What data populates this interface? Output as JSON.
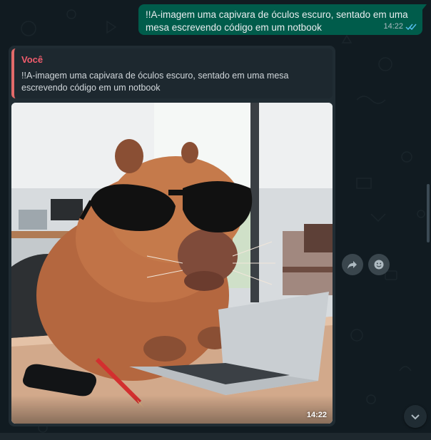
{
  "outgoing_message": {
    "text": "!!A-imagem uma capivara de óculos escuro, sentado em uma mesa escrevendo código em um notbook",
    "time": "14:22",
    "status_icon": "double-check-icon",
    "status_color": "#53bdeb"
  },
  "incoming_message": {
    "quote_author": "Você",
    "quote_text": "!!A-imagem uma capivara de óculos escuro, sentado em uma mesa escrevendo código em um notbook",
    "image_time": "14:22",
    "image_alt": "capybara-with-sunglasses-using-laptop"
  },
  "actions": {
    "forward_icon": "forward-icon",
    "react_icon": "emoji-icon",
    "scroll_down_icon": "chevron-down-icon"
  },
  "colors": {
    "outgoing_bubble": "#005c4b",
    "incoming_bubble": "#202c33",
    "quote_accent": "#f15c6d"
  }
}
